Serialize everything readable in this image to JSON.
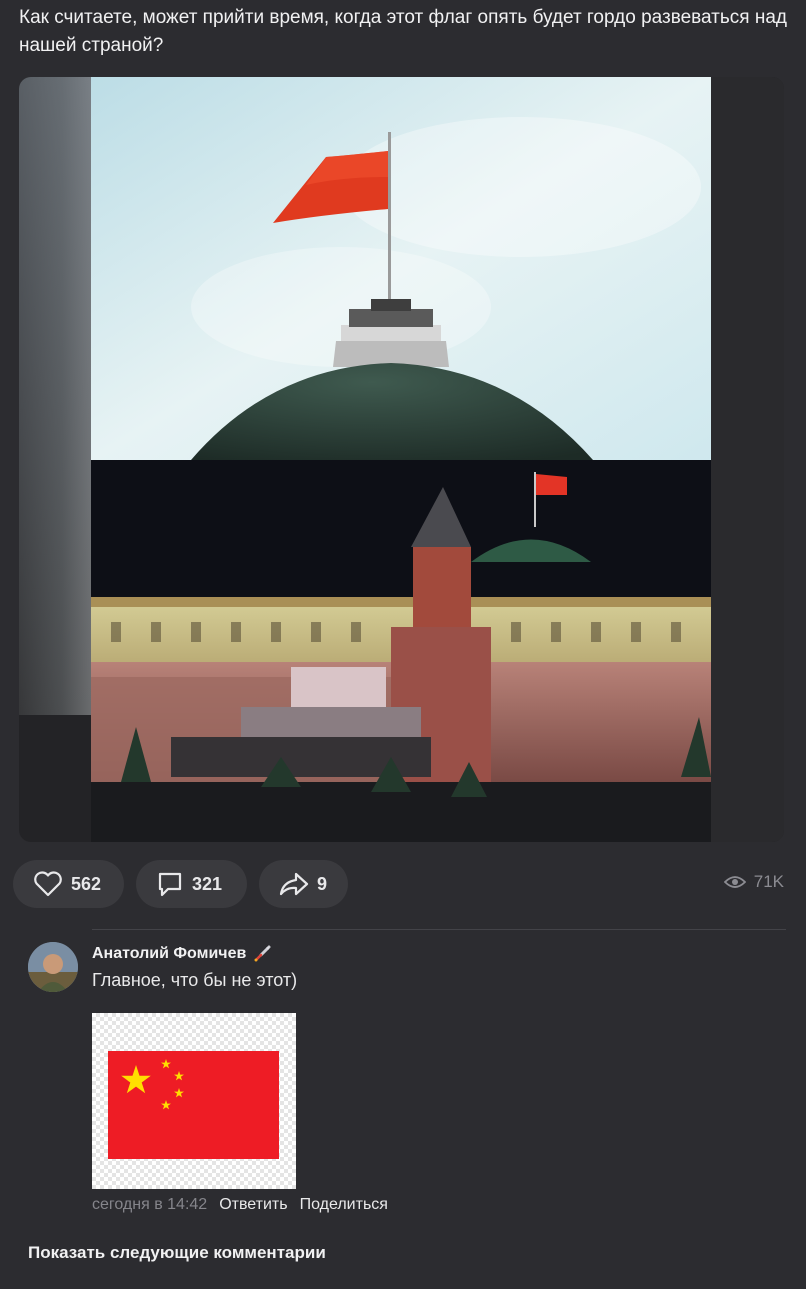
{
  "post": {
    "text": "Как считаете, может прийти время, когда этот флаг опять будет гордо развеваться над нашей страной?"
  },
  "actions": {
    "likes": "562",
    "comments": "321",
    "shares": "9",
    "views": "71K"
  },
  "comment": {
    "author": "Анатолий Фомичев",
    "badge_icon": "rocket-icon",
    "text": "Главное, что бы не этот)",
    "time": "сегодня в 14:42",
    "reply_label": "Ответить",
    "share_label": "Поделиться"
  },
  "show_more_label": "Показать следующие комментарии",
  "colors": {
    "background": "#2c2c30",
    "pill": "#3a3a3e",
    "muted_text": "#85858b",
    "flag_red": "#ee1c25",
    "flag_star": "#ffde00"
  }
}
